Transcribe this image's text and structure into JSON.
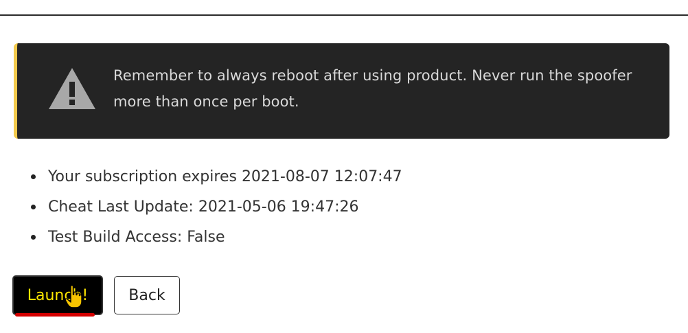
{
  "alert": {
    "icon": "warning-triangle-icon",
    "message": "Remember to always reboot after using product. Never run the spoofer more than once per boot.",
    "accent_color": "#f2c94c",
    "background_color": "#242424"
  },
  "info": {
    "items": [
      "Your subscription expires 2021-08-07 12:07:47",
      "Cheat Last Update: 2021-05-06 19:47:26",
      "Test Build Access: False"
    ]
  },
  "actions": {
    "launch_label": "Launch!",
    "back_label": "Back",
    "launch_text_color": "#ffe600",
    "launch_bg_color": "#000000",
    "underline_color": "#d40000"
  },
  "cursor": {
    "icon": "hand-pointer-icon"
  }
}
